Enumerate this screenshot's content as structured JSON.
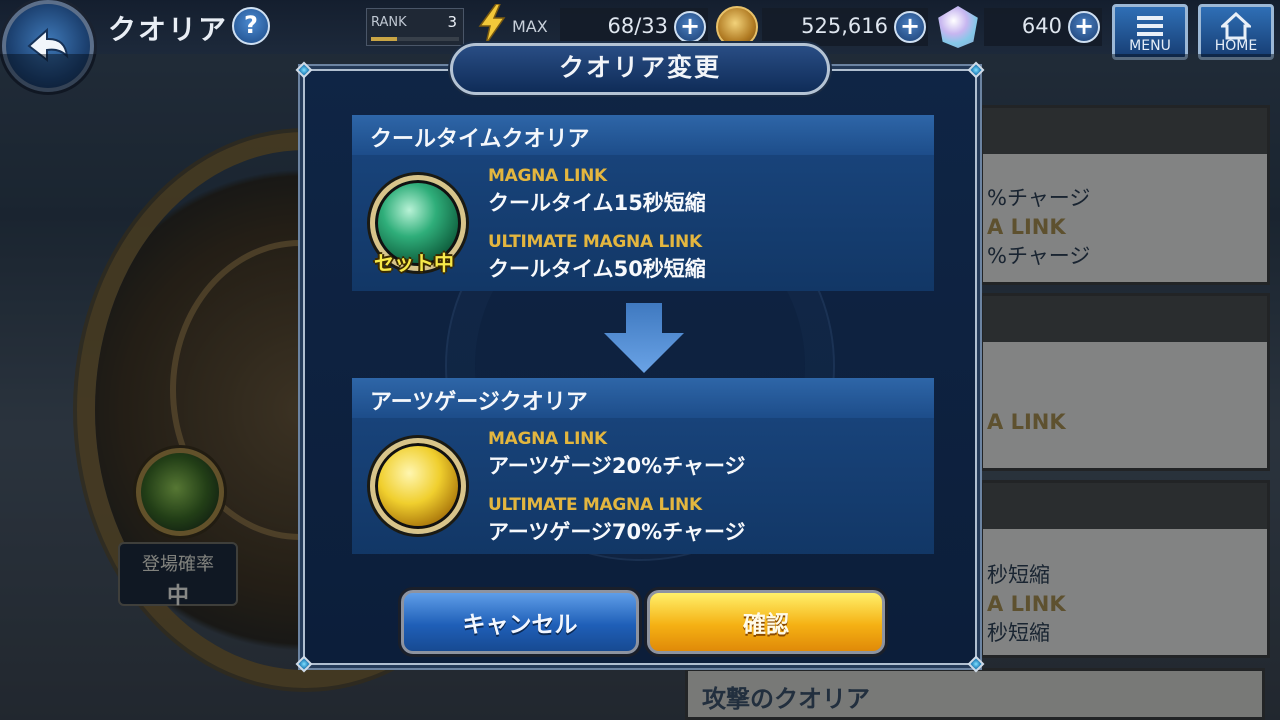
{
  "header": {
    "title": "クオリア",
    "help_symbol": "?",
    "rank_label": "RANK",
    "rank_value": "3",
    "rank_progress": 0.3,
    "stamina_max_label": "MAX",
    "stamina_value": "68/33",
    "coins_value": "525,616",
    "gems_value": "640",
    "plus_symbol": "+",
    "menu_label": "MENU",
    "home_label": "HOME"
  },
  "dialog": {
    "title": "クオリア変更",
    "current": {
      "name": "クールタイムクオリア",
      "badge": "セット中",
      "effects": [
        {
          "label": "MAGNA LINK",
          "text": "クールタイム15秒短縮"
        },
        {
          "label": "ULTIMATE MAGNA LINK",
          "text": "クールタイム50秒短縮"
        }
      ]
    },
    "new": {
      "name": "アーツゲージクオリア",
      "effects": [
        {
          "label": "MAGNA LINK",
          "text": "アーツゲージ20%チャージ"
        },
        {
          "label": "ULTIMATE MAGNA LINK",
          "text": "アーツゲージ70%チャージ"
        }
      ]
    },
    "cancel_label": "キャンセル",
    "confirm_label": "確認"
  },
  "background": {
    "rate_label": "登場確率",
    "rate_value": "中",
    "right_panel_texts": [
      "%チャージ",
      "A LINK",
      "%チャージ",
      "A LINK",
      "秒短縮",
      "A LINK",
      "秒短縮"
    ],
    "bottom_panel_title": "攻撃のクオリア"
  },
  "colors": {
    "accent_gold": "#e3b63f",
    "panel_blue": "#1d4d8a",
    "confirm_orange": "#f5b114",
    "cancel_blue": "#1f5fb8"
  }
}
